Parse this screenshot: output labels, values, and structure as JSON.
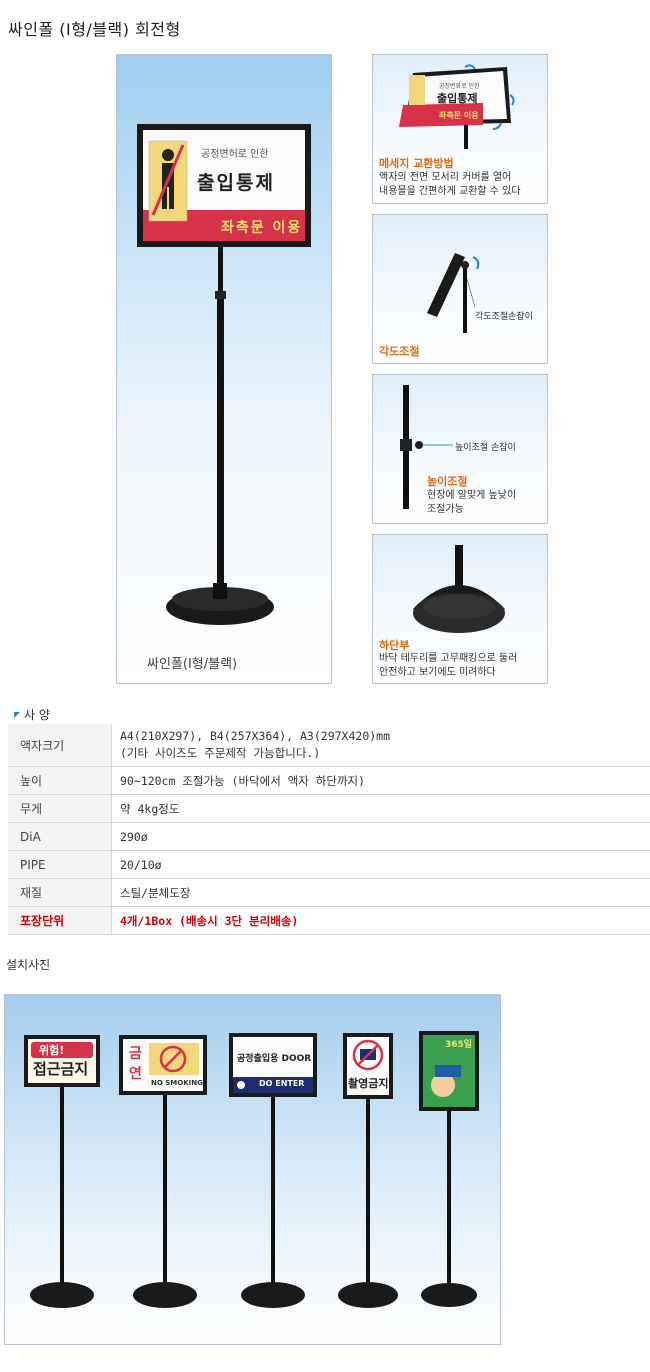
{
  "title": "싸인폴 (I형/블랙) 회전형",
  "main": {
    "caption": "싸인폴(I형/블랙)",
    "sign": {
      "line1": "공정변허로 인한",
      "line2": "출입통제",
      "strip": "좌측문 이용"
    }
  },
  "features": [
    {
      "title": "메세지 교환방법",
      "desc1": "액자의 전면 모서리 커버를 열어",
      "desc2": "내용물을 간편하게 교환할 수 있다",
      "sign_line2": "출입통제",
      "sign_strip": "좌측문 이용",
      "sign_line1": "공정변화로 인한"
    },
    {
      "title": "각도조절",
      "label": "각도조절손잡이"
    },
    {
      "title": "높이조절",
      "label": "높이조절 손잡이",
      "desc1": "현장에 알맞게 높낮이",
      "desc2": "조절가능"
    },
    {
      "title": "하단부",
      "desc1": "바닥 테두리를 고무패킹으로 둘러",
      "desc2": "안전하고 보기에도 미려하다"
    }
  ],
  "spec": {
    "heading": "사 양",
    "rows": [
      {
        "k": "액자크기",
        "v1": "A4(210X297), B4(257X364), A3(297X420)mm",
        "v2": "(기타 사이즈도 주문제작 가능합니다.)"
      },
      {
        "k": "높이",
        "v1": "90~120cm 조절가능 (바닥에서 액자 하단까지)"
      },
      {
        "k": "무게",
        "v1": "약 4kg정도"
      },
      {
        "k": "DiA",
        "v1": "290ø"
      },
      {
        "k": "PIPE",
        "v1": "20/10ø"
      },
      {
        "k": "재질",
        "v1": "스틸/분체도장"
      },
      {
        "k": "포장단위",
        "v1": "4개/1Box (배송시 3단 분리배송)"
      }
    ]
  },
  "install": {
    "label": "설치사진",
    "signs": [
      {
        "top": "위험!",
        "bottom": "접근금지"
      },
      {
        "left1": "금",
        "left2": "연",
        "bottom": "NO SMOKING"
      },
      {
        "top": "공정출입용 DOOR",
        "bottom": "DO ENTER"
      },
      {
        "bottom": "촬영금지"
      },
      {
        "top": "365일"
      }
    ]
  },
  "colors": {
    "accent_orange": "#e06a10",
    "warning_red": "#d40000",
    "sign_red": "#d8314a"
  }
}
